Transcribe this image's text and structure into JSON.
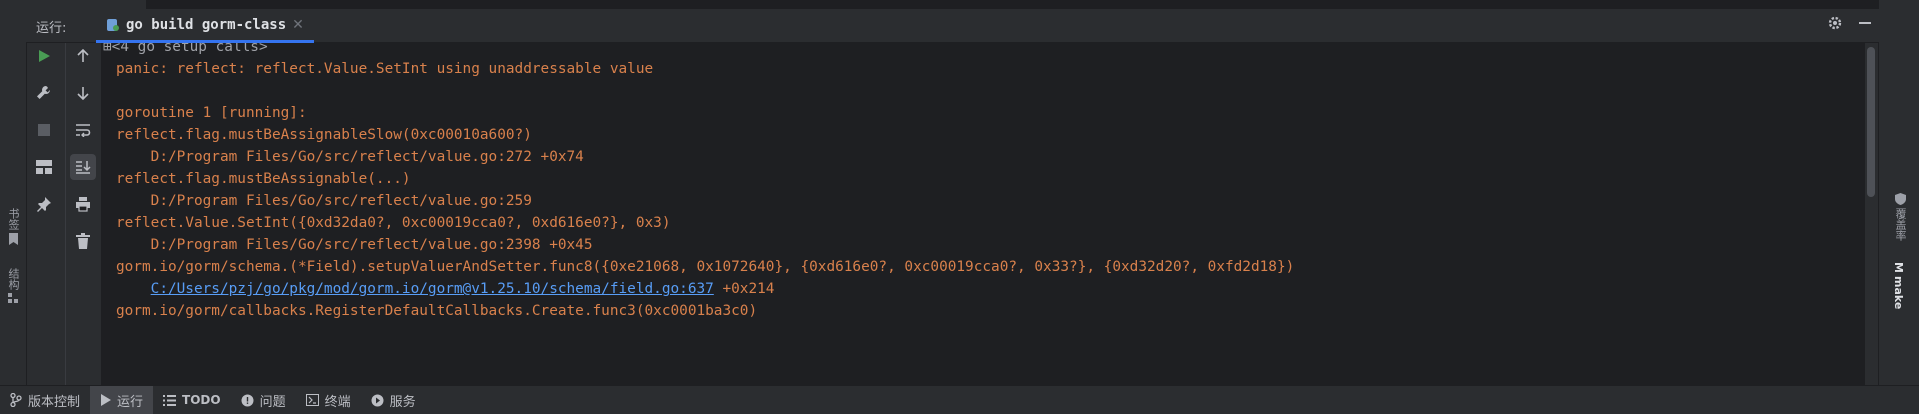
{
  "left_strip": {
    "bookmarks_label": "书签",
    "structure_label": "结构"
  },
  "right_strip": {
    "coverage_label": "覆盖率",
    "make_label": "make"
  },
  "run_panel": {
    "label": "运行:",
    "tab_title": "go build gorm-class"
  },
  "console": {
    "setup_calls": "⊞<4 go setup calls>",
    "lines": [
      "panic: reflect: reflect.Value.SetInt using unaddressable value",
      "",
      "goroutine 1 [running]:",
      "reflect.flag.mustBeAssignableSlow(0xc00010a600?)",
      "    D:/Program Files/Go/src/reflect/value.go:272 +0x74",
      "reflect.flag.mustBeAssignable(...)",
      "    D:/Program Files/Go/src/reflect/value.go:259",
      "reflect.Value.SetInt({0xd32da0?, 0xc00019cca0?, 0xd616e0?}, 0x3)",
      "    D:/Program Files/Go/src/reflect/value.go:2398 +0x45",
      "gorm.io/gorm/schema.(*Field).setupValuerAndSetter.func8({0xe21068, 0x1072640}, {0xd616e0?, 0xc00019cca0?, 0x33?}, {0xd32d20?, 0xfd2d18})"
    ],
    "link_line": {
      "link": "C:/Users/pzj/go/pkg/mod/gorm.io/gorm@v1.25.10/schema/field.go:637",
      "suffix": " +0x214"
    },
    "last_line": "gorm.io/gorm/callbacks.RegisterDefaultCallbacks.Create.func3(0xc0001ba3c0)"
  },
  "statusbar": {
    "items": [
      {
        "label": "版本控制",
        "icon": "branch-icon"
      },
      {
        "label": "运行",
        "icon": "play-icon"
      },
      {
        "label": "TODO",
        "icon": "list-icon"
      },
      {
        "label": "问题",
        "icon": "info-icon"
      },
      {
        "label": "终端",
        "icon": "terminal-icon"
      },
      {
        "label": "服务",
        "icon": "services-icon"
      }
    ]
  },
  "colors": {
    "accent": "#3574f0",
    "output": "#d9814c",
    "link": "#589df6",
    "run_green": "#499c54"
  }
}
